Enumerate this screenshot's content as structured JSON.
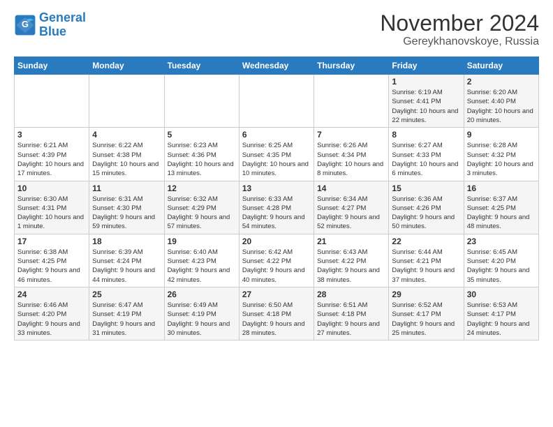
{
  "logo": {
    "line1": "General",
    "line2": "Blue"
  },
  "title": "November 2024",
  "subtitle": "Gereykhanovskoye, Russia",
  "days_of_week": [
    "Sunday",
    "Monday",
    "Tuesday",
    "Wednesday",
    "Thursday",
    "Friday",
    "Saturday"
  ],
  "weeks": [
    [
      {
        "day": "",
        "info": ""
      },
      {
        "day": "",
        "info": ""
      },
      {
        "day": "",
        "info": ""
      },
      {
        "day": "",
        "info": ""
      },
      {
        "day": "",
        "info": ""
      },
      {
        "day": "1",
        "info": "Sunrise: 6:19 AM\nSunset: 4:41 PM\nDaylight: 10 hours and 22 minutes."
      },
      {
        "day": "2",
        "info": "Sunrise: 6:20 AM\nSunset: 4:40 PM\nDaylight: 10 hours and 20 minutes."
      }
    ],
    [
      {
        "day": "3",
        "info": "Sunrise: 6:21 AM\nSunset: 4:39 PM\nDaylight: 10 hours and 17 minutes."
      },
      {
        "day": "4",
        "info": "Sunrise: 6:22 AM\nSunset: 4:38 PM\nDaylight: 10 hours and 15 minutes."
      },
      {
        "day": "5",
        "info": "Sunrise: 6:23 AM\nSunset: 4:36 PM\nDaylight: 10 hours and 13 minutes."
      },
      {
        "day": "6",
        "info": "Sunrise: 6:25 AM\nSunset: 4:35 PM\nDaylight: 10 hours and 10 minutes."
      },
      {
        "day": "7",
        "info": "Sunrise: 6:26 AM\nSunset: 4:34 PM\nDaylight: 10 hours and 8 minutes."
      },
      {
        "day": "8",
        "info": "Sunrise: 6:27 AM\nSunset: 4:33 PM\nDaylight: 10 hours and 6 minutes."
      },
      {
        "day": "9",
        "info": "Sunrise: 6:28 AM\nSunset: 4:32 PM\nDaylight: 10 hours and 3 minutes."
      }
    ],
    [
      {
        "day": "10",
        "info": "Sunrise: 6:30 AM\nSunset: 4:31 PM\nDaylight: 10 hours and 1 minute."
      },
      {
        "day": "11",
        "info": "Sunrise: 6:31 AM\nSunset: 4:30 PM\nDaylight: 9 hours and 59 minutes."
      },
      {
        "day": "12",
        "info": "Sunrise: 6:32 AM\nSunset: 4:29 PM\nDaylight: 9 hours and 57 minutes."
      },
      {
        "day": "13",
        "info": "Sunrise: 6:33 AM\nSunset: 4:28 PM\nDaylight: 9 hours and 54 minutes."
      },
      {
        "day": "14",
        "info": "Sunrise: 6:34 AM\nSunset: 4:27 PM\nDaylight: 9 hours and 52 minutes."
      },
      {
        "day": "15",
        "info": "Sunrise: 6:36 AM\nSunset: 4:26 PM\nDaylight: 9 hours and 50 minutes."
      },
      {
        "day": "16",
        "info": "Sunrise: 6:37 AM\nSunset: 4:25 PM\nDaylight: 9 hours and 48 minutes."
      }
    ],
    [
      {
        "day": "17",
        "info": "Sunrise: 6:38 AM\nSunset: 4:25 PM\nDaylight: 9 hours and 46 minutes."
      },
      {
        "day": "18",
        "info": "Sunrise: 6:39 AM\nSunset: 4:24 PM\nDaylight: 9 hours and 44 minutes."
      },
      {
        "day": "19",
        "info": "Sunrise: 6:40 AM\nSunset: 4:23 PM\nDaylight: 9 hours and 42 minutes."
      },
      {
        "day": "20",
        "info": "Sunrise: 6:42 AM\nSunset: 4:22 PM\nDaylight: 9 hours and 40 minutes."
      },
      {
        "day": "21",
        "info": "Sunrise: 6:43 AM\nSunset: 4:22 PM\nDaylight: 9 hours and 38 minutes."
      },
      {
        "day": "22",
        "info": "Sunrise: 6:44 AM\nSunset: 4:21 PM\nDaylight: 9 hours and 37 minutes."
      },
      {
        "day": "23",
        "info": "Sunrise: 6:45 AM\nSunset: 4:20 PM\nDaylight: 9 hours and 35 minutes."
      }
    ],
    [
      {
        "day": "24",
        "info": "Sunrise: 6:46 AM\nSunset: 4:20 PM\nDaylight: 9 hours and 33 minutes."
      },
      {
        "day": "25",
        "info": "Sunrise: 6:47 AM\nSunset: 4:19 PM\nDaylight: 9 hours and 31 minutes."
      },
      {
        "day": "26",
        "info": "Sunrise: 6:49 AM\nSunset: 4:19 PM\nDaylight: 9 hours and 30 minutes."
      },
      {
        "day": "27",
        "info": "Sunrise: 6:50 AM\nSunset: 4:18 PM\nDaylight: 9 hours and 28 minutes."
      },
      {
        "day": "28",
        "info": "Sunrise: 6:51 AM\nSunset: 4:18 PM\nDaylight: 9 hours and 27 minutes."
      },
      {
        "day": "29",
        "info": "Sunrise: 6:52 AM\nSunset: 4:17 PM\nDaylight: 9 hours and 25 minutes."
      },
      {
        "day": "30",
        "info": "Sunrise: 6:53 AM\nSunset: 4:17 PM\nDaylight: 9 hours and 24 minutes."
      }
    ]
  ]
}
